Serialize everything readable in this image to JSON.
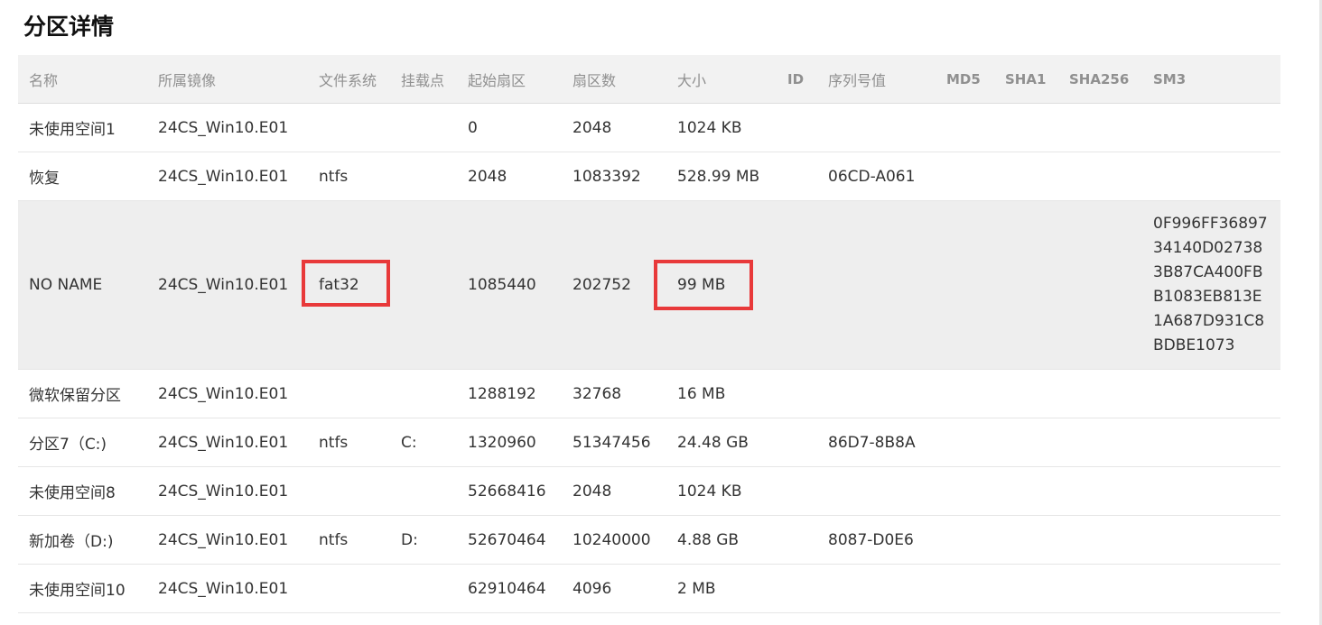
{
  "page": {
    "title": "分区详情"
  },
  "table": {
    "headers": [
      "名称",
      "所属镜像",
      "文件系统",
      "挂载点",
      "起始扇区",
      "扇区数",
      "大小",
      "ID",
      "序列号值",
      "MD5",
      "SHA1",
      "SHA256",
      "SM3"
    ],
    "rows": [
      [
        "未使用空间1",
        "24CS_Win10.E01",
        "",
        "",
        "0",
        "2048",
        "1024 KB",
        "",
        "",
        "",
        "",
        "",
        ""
      ],
      [
        "恢复",
        "24CS_Win10.E01",
        "ntfs",
        "",
        "2048",
        "1083392",
        "528.99 MB",
        "",
        "06CD-A061",
        "",
        "",
        "",
        ""
      ],
      [
        "NO NAME",
        "24CS_Win10.E01",
        "fat32",
        "",
        "1085440",
        "202752",
        "99 MB",
        "",
        "",
        "",
        "",
        "",
        "0F996FF36897 34140D02738 3B87CA400FB B1083EB813E 1A687D931C8 BDBE1073"
      ],
      [
        "微软保留分区",
        "24CS_Win10.E01",
        "",
        "",
        "1288192",
        "32768",
        "16 MB",
        "",
        "",
        "",
        "",
        "",
        ""
      ],
      [
        "分区7（C:)",
        "24CS_Win10.E01",
        "ntfs",
        "C:",
        "1320960",
        "51347456",
        "24.48 GB",
        "",
        "86D7-8B8A",
        "",
        "",
        "",
        ""
      ],
      [
        "未使用空间8",
        "24CS_Win10.E01",
        "",
        "",
        "52668416",
        "2048",
        "1024 KB",
        "",
        "",
        "",
        "",
        "",
        ""
      ],
      [
        "新加卷（D:)",
        "24CS_Win10.E01",
        "ntfs",
        "D:",
        "52670464",
        "10240000",
        "4.88 GB",
        "",
        "8087-D0E6",
        "",
        "",
        "",
        ""
      ],
      [
        "未使用空间10",
        "24CS_Win10.E01",
        "",
        "",
        "62910464",
        "4096",
        "2 MB",
        "",
        "",
        "",
        "",
        "",
        ""
      ]
    ]
  },
  "highlights": {
    "color": "#e8393a",
    "cells": [
      "NO NAME.文件系统",
      "NO NAME.大小"
    ]
  },
  "colors": {
    "header_bg": "#f2f2f2",
    "highlight_row_bg": "#eeeeee",
    "header_text": "#909090",
    "body_text": "#333333"
  }
}
